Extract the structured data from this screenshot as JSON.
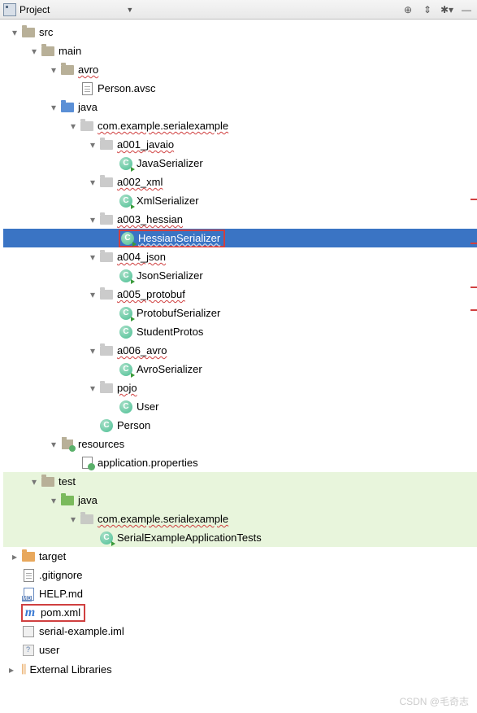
{
  "toolbar": {
    "title": "Project"
  },
  "tree": {
    "src": "src",
    "main": "main",
    "avro": "avro",
    "person_avsc": "Person.avsc",
    "java": "java",
    "pkg_main": "com.example.serialexample",
    "a001": "a001_javaio",
    "java_ser": "JavaSerializer",
    "a002": "a002_xml",
    "xml_ser": "XmlSerializer",
    "a003": "a003_hessian",
    "hessian_ser": "HessianSerializer",
    "a004": "a004_json",
    "json_ser": "JsonSerializer",
    "a005": "a005_protobuf",
    "proto_ser": "ProtobufSerializer",
    "student_protos": "StudentProtos",
    "a006": "a006_avro",
    "avro_ser": "AvroSerializer",
    "pojo": "pojo",
    "user_cls": "User",
    "person_cls": "Person",
    "resources": "resources",
    "app_props": "application.properties",
    "test": "test",
    "java_test": "java",
    "pkg_test": "com.example.serialexample",
    "test_cls": "SerialExampleApplicationTests",
    "target": "target",
    "gitignore": ".gitignore",
    "help_md": "HELP.md",
    "pom": "pom.xml",
    "iml": "serial-example.iml",
    "user_file": "user"
  },
  "ext_lib": "External Libraries",
  "watermark": "CSDN @毛奇志"
}
